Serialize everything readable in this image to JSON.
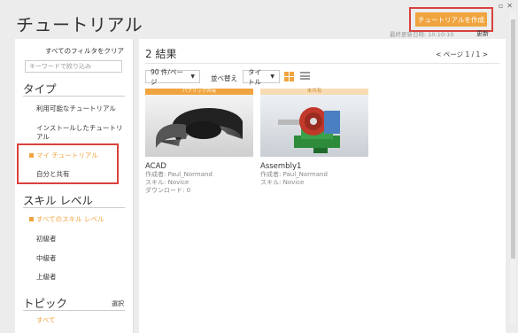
{
  "window": {
    "icons": [
      "restore-icon",
      "close-icon"
    ]
  },
  "header": {
    "title": "チュートリアル",
    "create_button": "チュートリアルを作成",
    "updated_label": "最終更新日時: 10:10:10",
    "updated_action": "更新"
  },
  "sidebar": {
    "clear_filters": "すべてのフィルタをクリア",
    "search_placeholder": "キーワードで絞り込み",
    "type_heading": "タイプ",
    "type_items": [
      "利用可能なチュートリアル",
      "インストールしたチュートリアル",
      "マイ チュートリアル",
      "自分と共有"
    ],
    "skill_heading": "スキル レベル",
    "skill_items": [
      "すべてのスキル レベル",
      "初級者",
      "中級者",
      "上級者"
    ],
    "topic_heading": "トピック",
    "topic_select": "選択",
    "topic_items": [
      "すべて"
    ]
  },
  "main": {
    "results": "2 結果",
    "pager": "<   ページ 1 / 1   >",
    "per_page": "90 件/ページ",
    "sort_label": "並べ替え",
    "sort_value": "タイトル",
    "cards": [
      {
        "ribbon": "パブリック共有",
        "title": "ACAD",
        "author": "作成者: Paul_Normand",
        "skill": "スキル: Novice",
        "downloads": "ダウンロード: 0"
      },
      {
        "ribbon": "未共有",
        "title": "Assembly1",
        "author": "作成者: Paul_Normand",
        "skill": "スキル: Novice"
      }
    ]
  },
  "colors": {
    "accent": "#f0a43f",
    "highlight": "#d9413e"
  }
}
